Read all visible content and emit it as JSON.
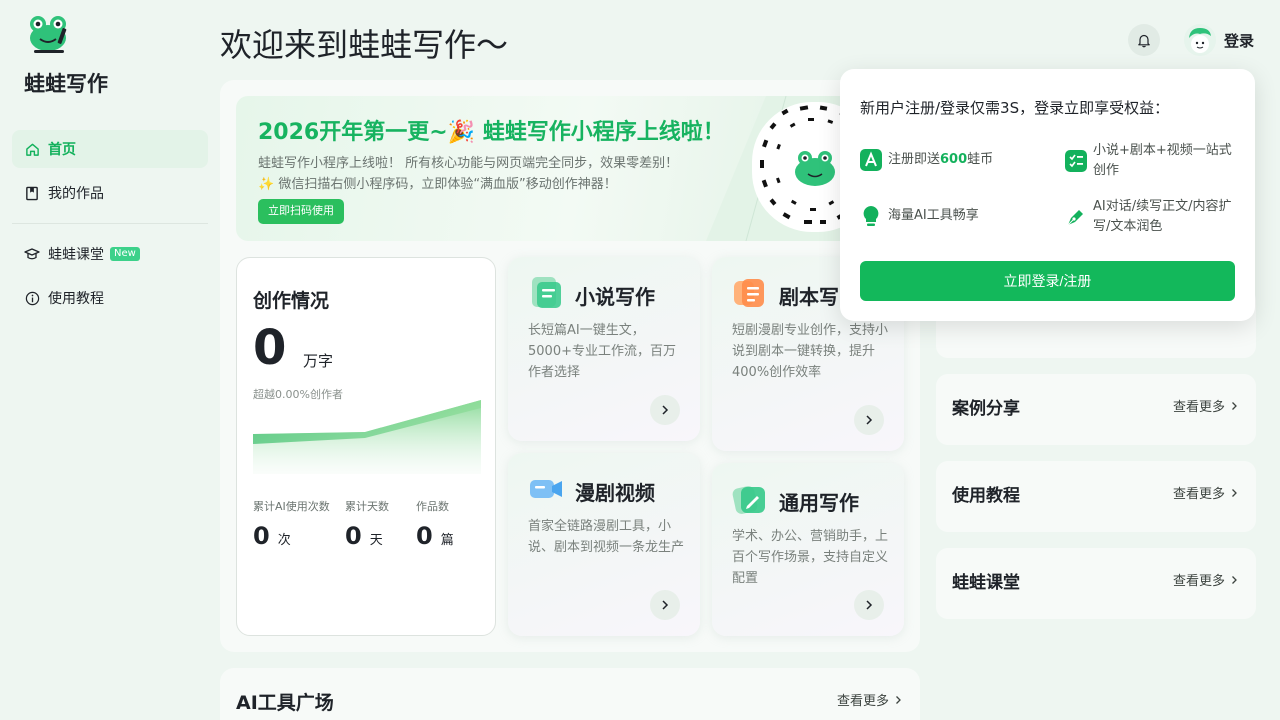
{
  "brand": {
    "name": "蛙蛙写作"
  },
  "nav": {
    "home": "首页",
    "works": "我的作品",
    "classroom": "蛙蛙课堂",
    "classroom_badge": "New",
    "tutorial": "使用教程"
  },
  "header": {
    "welcome": "欢迎来到蛙蛙写作～",
    "login": "登录"
  },
  "banner": {
    "title": "2026开年第一更~🎉 蛙蛙写作小程序上线啦！",
    "line1": "蛙蛙写作小程序上线啦！ 所有核心功能与网页端完全同步，效果零差别！",
    "line2": "✨ 微信扫描右侧小程序码，立即体验“满血版”移动创作神器！",
    "button": "立即扫码使用"
  },
  "stats": {
    "title": "创作情况",
    "words": "0",
    "words_unit": "万字",
    "surpass": "超越0.00%创作者",
    "ai_label": "累计AI使用次数",
    "ai_value": "0",
    "ai_unit": "次",
    "days_label": "累计天数",
    "days_value": "0",
    "days_unit": "天",
    "works_label": "作品数",
    "works_value": "0",
    "works_unit": "篇"
  },
  "features": {
    "novel": {
      "title": "小说写作",
      "desc": "长短篇AI一键生文，5000+专业工作流，百万作者选择"
    },
    "script": {
      "title": "剧本写",
      "desc": "短剧漫剧专业创作，支持小说到剧本一键转换，提升400%创作效率"
    },
    "video": {
      "title": "漫剧视频",
      "desc": "首家全链路漫剧工具，小说、剧本到视频一条龙生产"
    },
    "general": {
      "title": "通用写作",
      "desc": "学术、办公、营销助手，上百个写作场景，支持自定义配置"
    }
  },
  "tools": {
    "title": "AI工具广场",
    "more": "查看更多"
  },
  "right": {
    "cases": {
      "title": "案例分享",
      "more": "查看更多"
    },
    "tutorial": {
      "title": "使用教程",
      "more": "查看更多"
    },
    "classroom": {
      "title": "蛙蛙课堂",
      "more": "查看更多"
    }
  },
  "popup": {
    "title": "新用户注册/登录仅需3S，登录立即享受权益：",
    "benefit1_pre": "注册即送",
    "benefit1_num": "600",
    "benefit1_post": "蛙币",
    "benefit2": "小说+剧本+视频一站式创作",
    "benefit3": "海量AI工具畅享",
    "benefit4": "AI对话/续写正文/内容扩写/文本润色",
    "button": "立即登录/注册"
  },
  "colors": {
    "accent": "#13b15c",
    "background": "#eef6f1"
  }
}
